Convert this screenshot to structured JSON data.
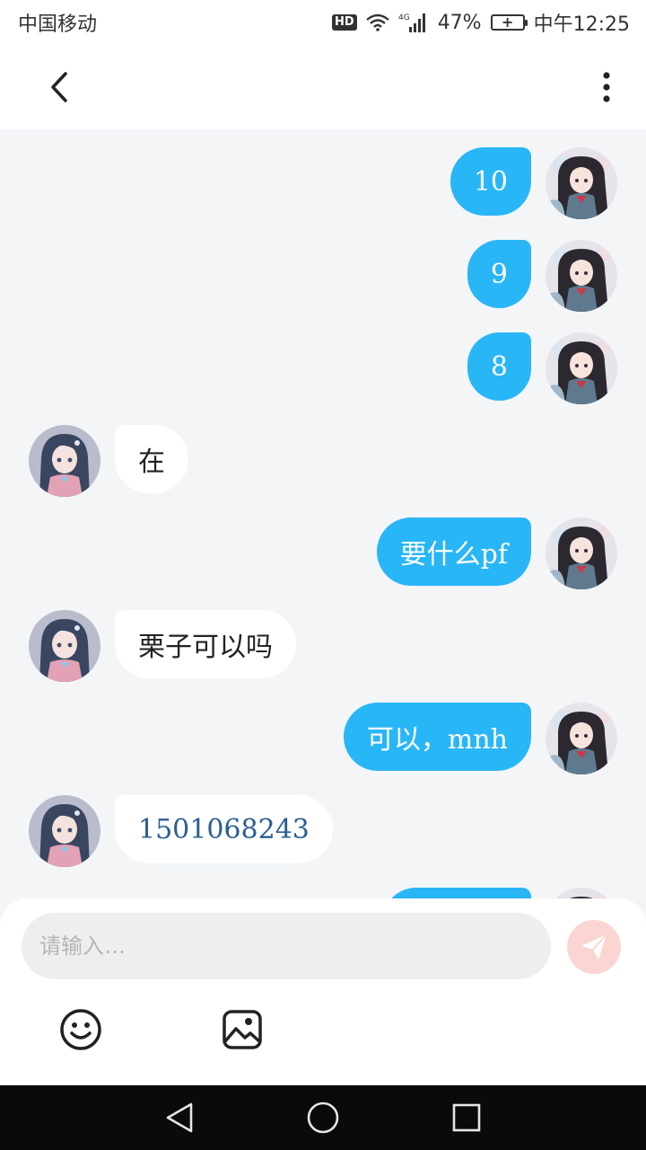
{
  "status_bar": {
    "carrier": "中国移动",
    "hd": "HD",
    "network": "4G",
    "battery_percent": "47%",
    "time": "中午12:25"
  },
  "messages": [
    {
      "from": "me",
      "text": "10"
    },
    {
      "from": "me",
      "text": "9"
    },
    {
      "from": "me",
      "text": "8"
    },
    {
      "from": "them",
      "text": "在"
    },
    {
      "from": "me",
      "text": "要什么pf"
    },
    {
      "from": "them",
      "text": "栗子可以吗"
    },
    {
      "from": "me",
      "text": "可以，mnh"
    },
    {
      "from": "them",
      "text": "1501068243"
    }
  ],
  "composer": {
    "placeholder": "请输入…"
  },
  "colors": {
    "sent_bubble": "#29b6f6",
    "received_bubble": "#ffffff",
    "send_button": "#fbd5d1",
    "chat_background": "#f3f5f7"
  },
  "icons": {
    "back": "chevron-left-icon",
    "more": "vertical-dots-icon",
    "send": "paper-plane-icon",
    "emoji": "smiley-icon",
    "image": "image-icon"
  }
}
